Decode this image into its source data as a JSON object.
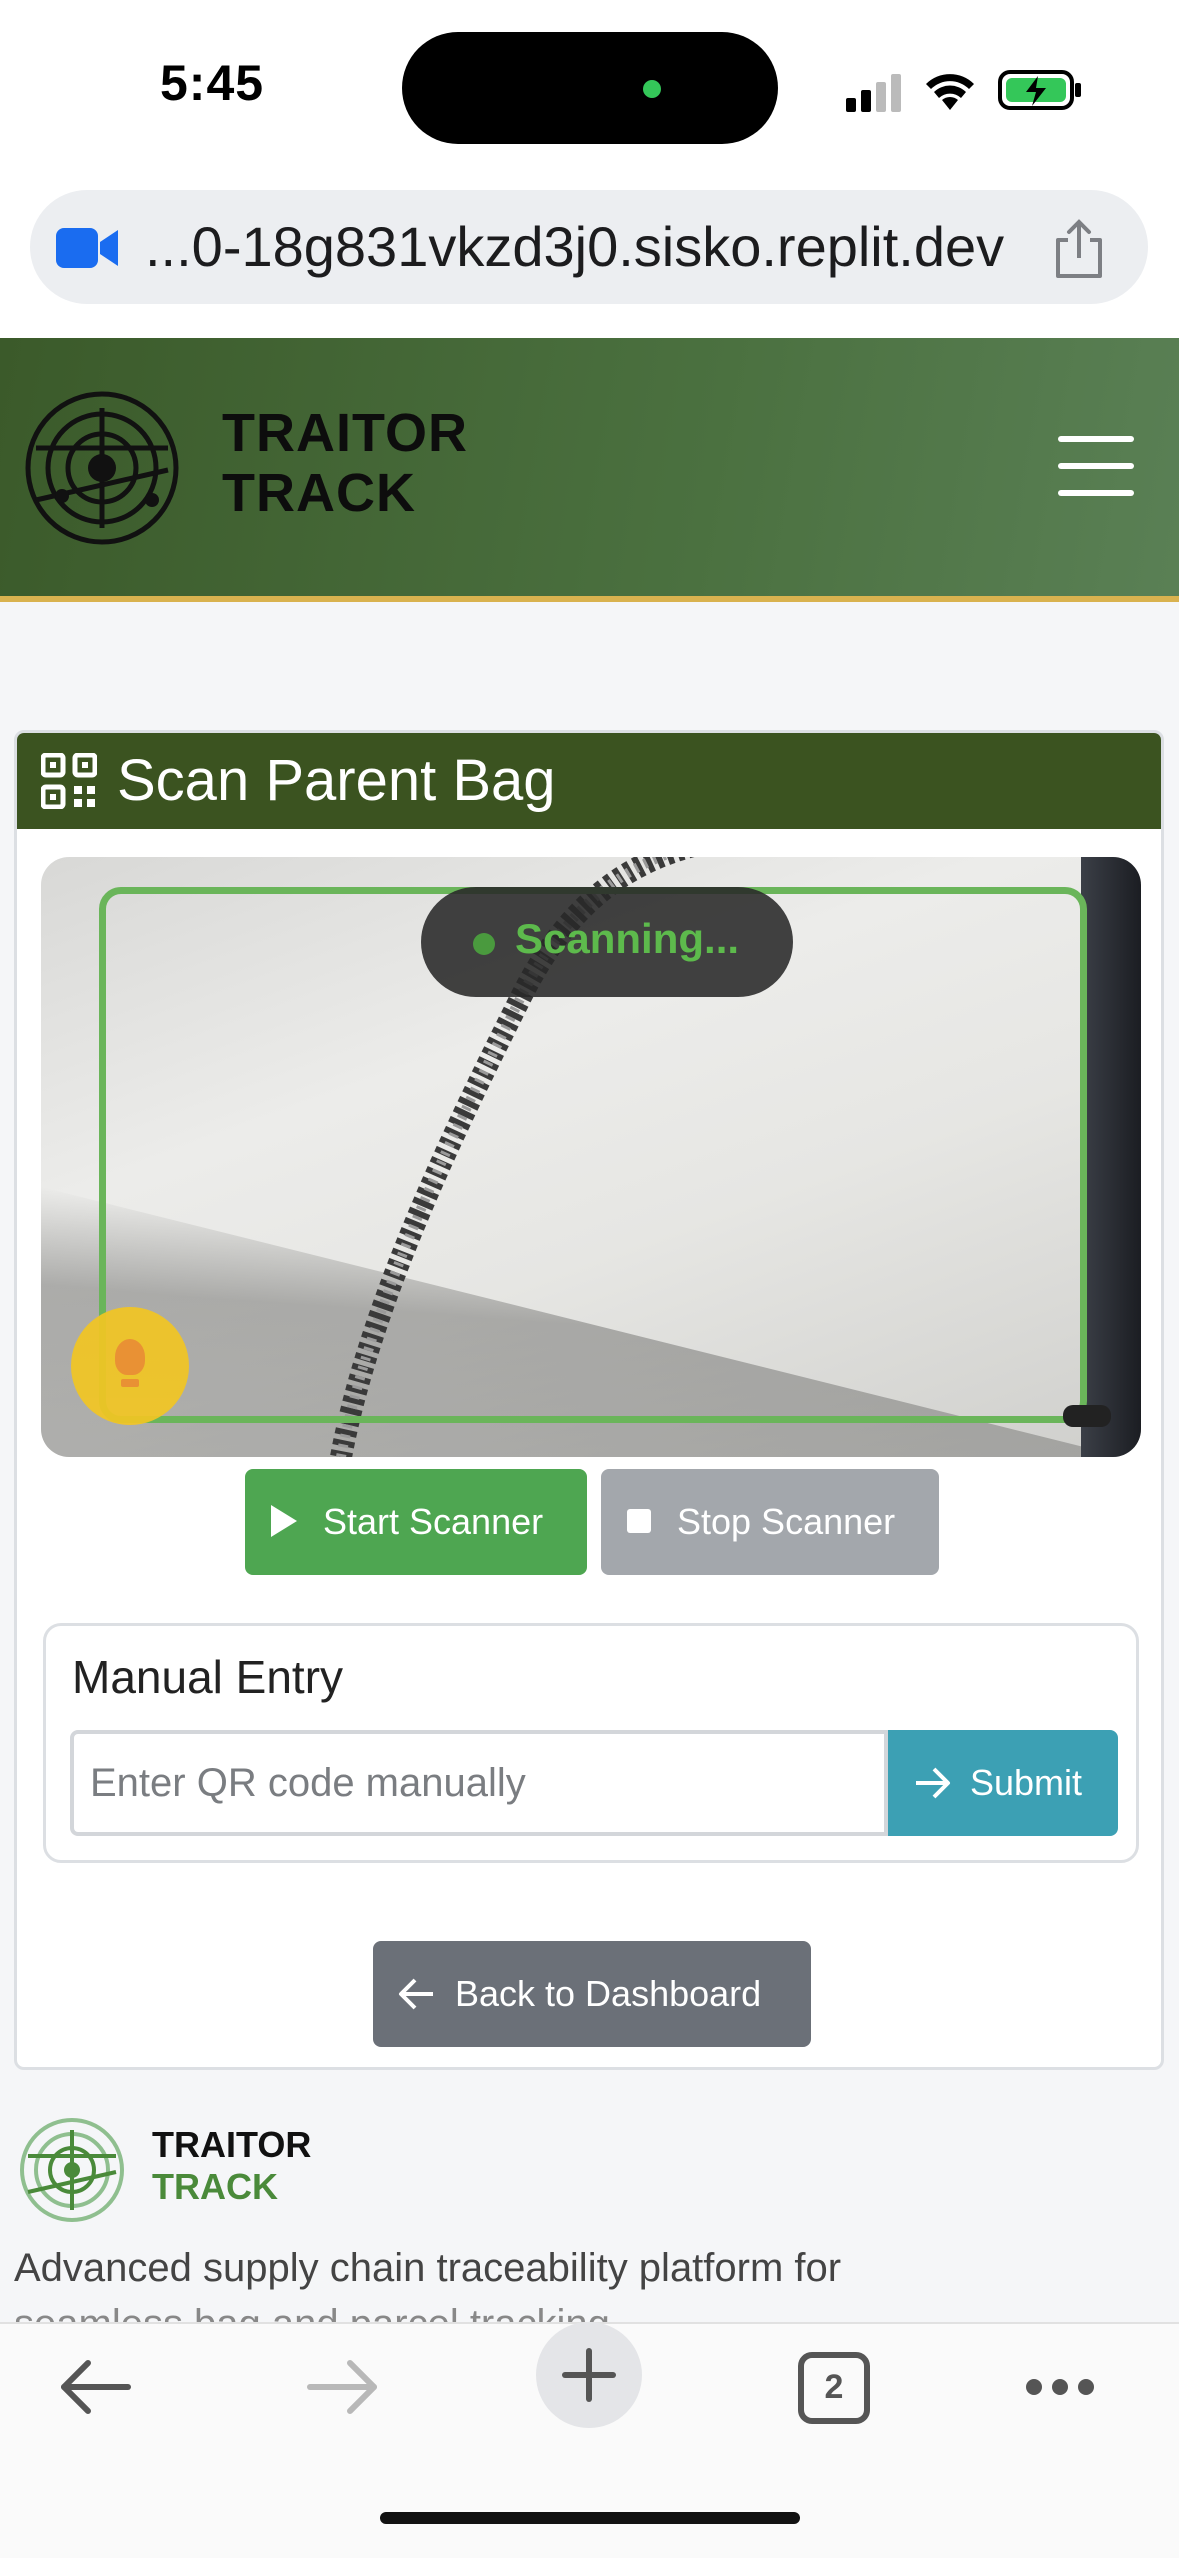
{
  "status_bar": {
    "time": "5:45"
  },
  "browser": {
    "url": "...0-18g831vkzd3j0.sisko.replit.dev",
    "tab_count": "2"
  },
  "header": {
    "brand_line1": "TRAITOR",
    "brand_line2": "TRACK"
  },
  "scan_card": {
    "title": "Scan Parent Bag",
    "scan_status": "Scanning...",
    "start_label": "Start Scanner",
    "stop_label": "Stop Scanner",
    "manual_title": "Manual Entry",
    "manual_placeholder": "Enter QR code manually",
    "manual_value": "",
    "submit_label": "Submit",
    "back_label": "Back to Dashboard"
  },
  "footer": {
    "brand_line1": "TRAITOR",
    "brand_line2": "TRACK",
    "description": "Advanced supply chain traceability platform for",
    "description_cut": "seamless bag and parcel tracking..."
  },
  "colors": {
    "header_green": "#4b7140",
    "card_header": "#3b5320",
    "start_green": "#4ea651",
    "stop_gray": "#a3a7ac",
    "submit_teal": "#3ca0b4",
    "back_gray": "#6b7078",
    "accent_gold": "#d9b24f"
  }
}
